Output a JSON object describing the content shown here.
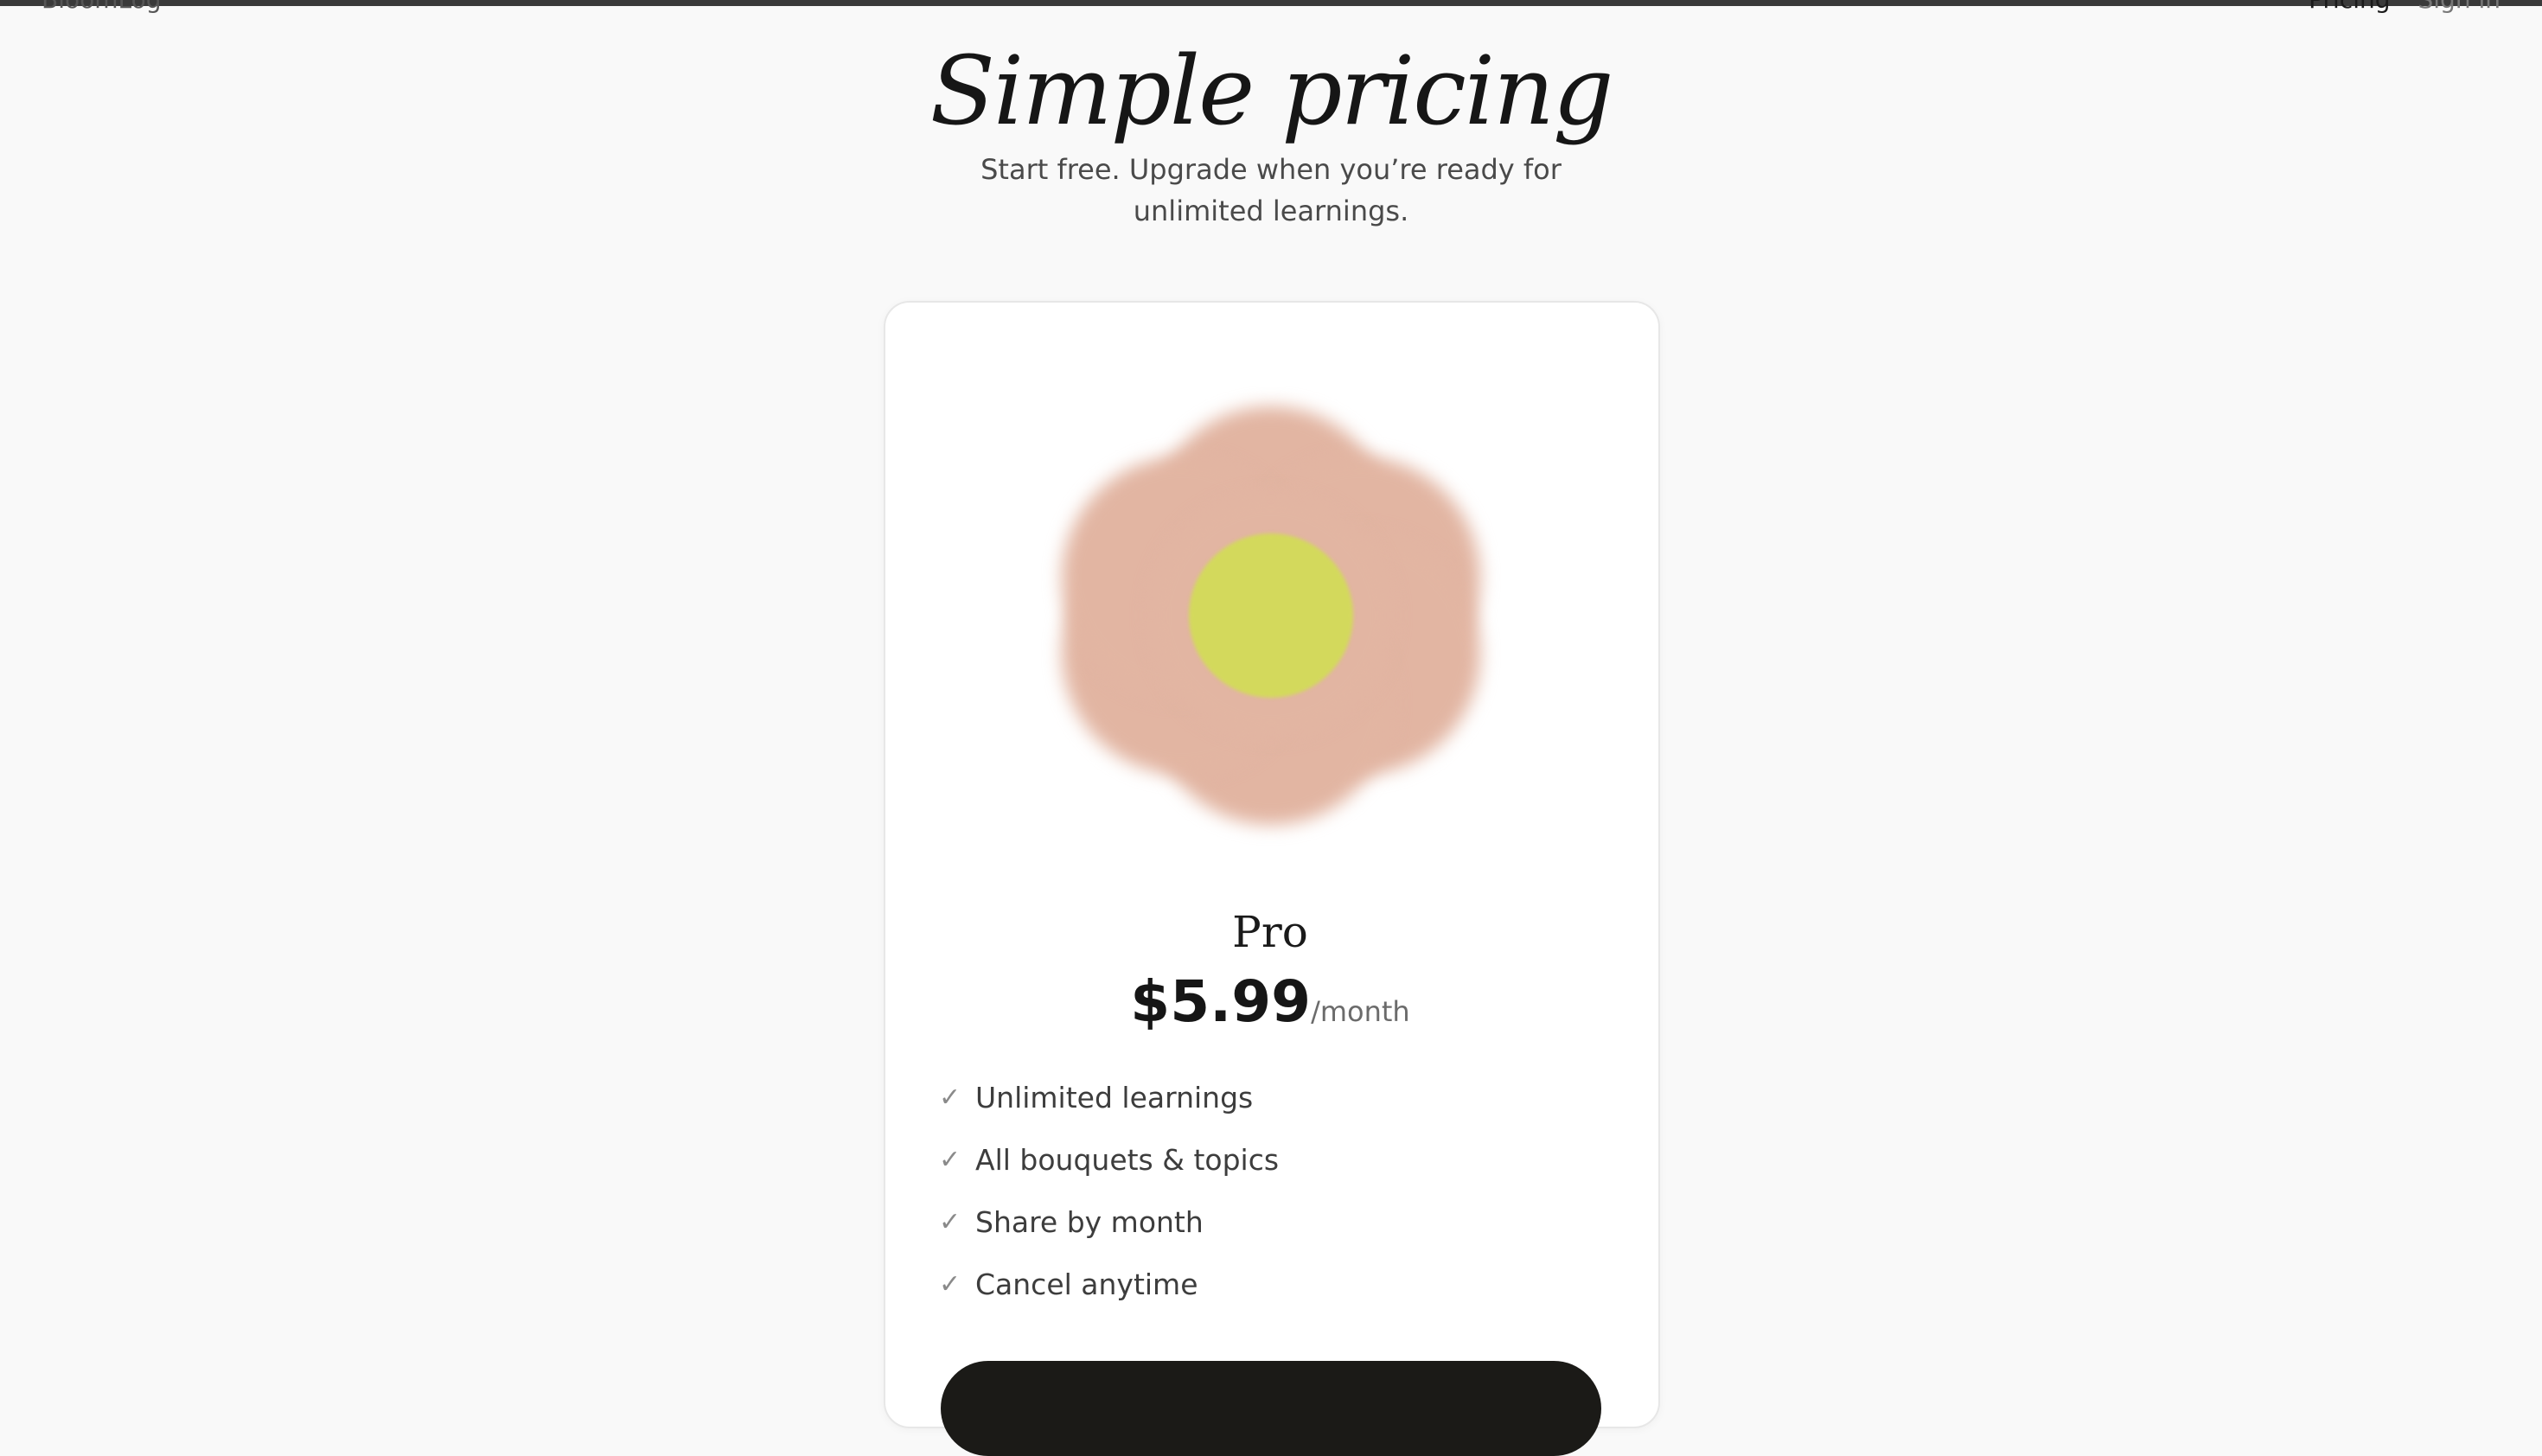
{
  "header": {
    "brand": "BloomLog",
    "nav": [
      {
        "label": "Pricing"
      },
      {
        "label": "Sign in"
      }
    ]
  },
  "hero": {
    "title": "Simple pricing",
    "subtitle": "Start free. Upgrade when you’re ready for unlimited learnings."
  },
  "plan": {
    "name": "Pro",
    "price": "$5.99",
    "period": "/month",
    "check_icon": "✓",
    "features": [
      "Unlimited learnings",
      "All bouquets & topics",
      "Share by month",
      "Cancel anytime"
    ],
    "cta_label": ""
  },
  "colors": {
    "petal": "#e2b5a2",
    "center": "#d3d95c",
    "cta": "#1b1a17"
  }
}
